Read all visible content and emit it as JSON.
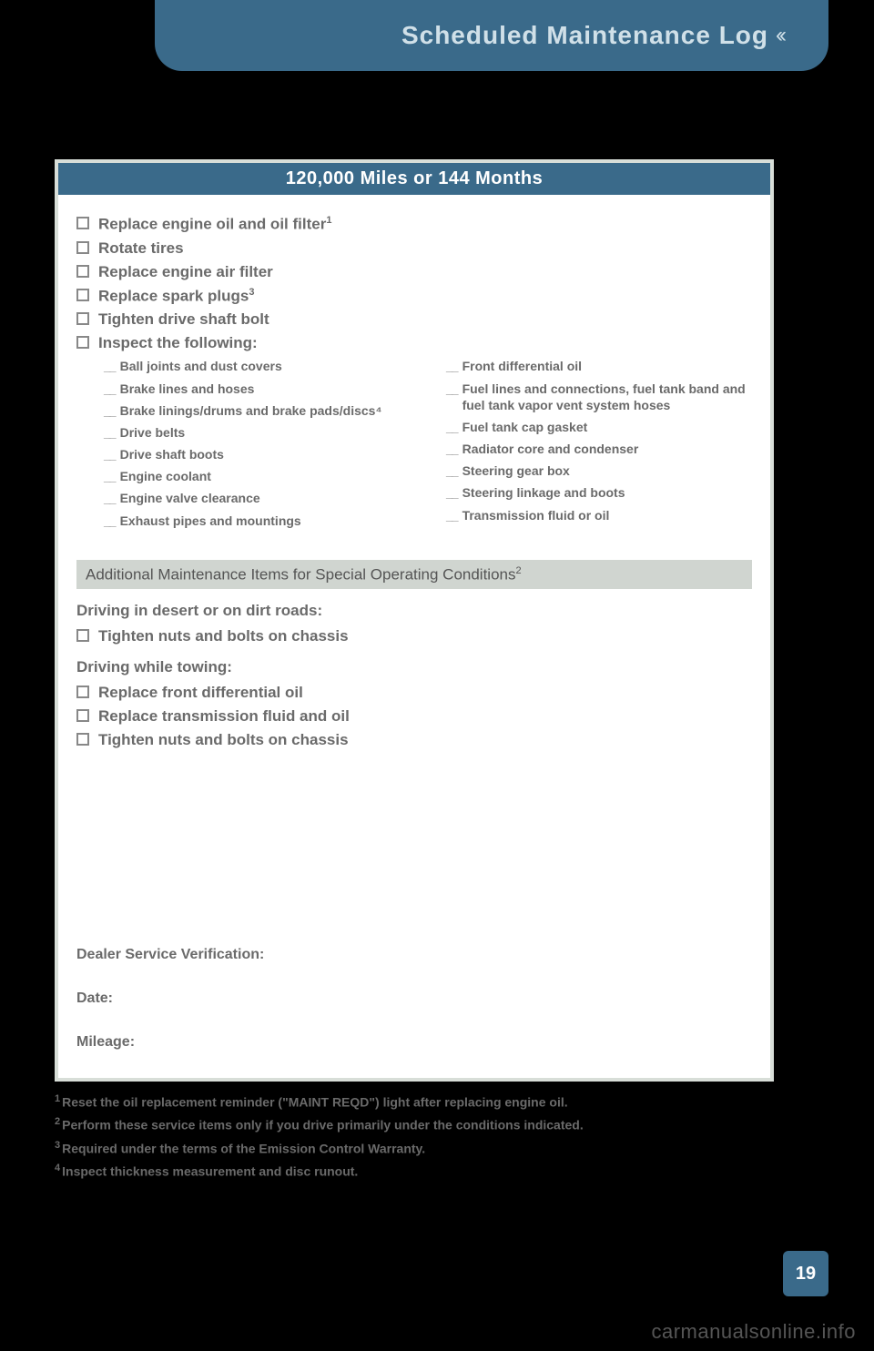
{
  "header": {
    "title": "Scheduled Maintenance Log",
    "chevrons": "‹‹"
  },
  "card": {
    "title": "120,000 Miles or 144 Months",
    "checklist": [
      {
        "text": "Replace engine oil and oil filter",
        "sup": "1"
      },
      {
        "text": "Rotate tires",
        "sup": ""
      },
      {
        "text": "Replace engine air filter",
        "sup": ""
      },
      {
        "text": "Replace spark plugs",
        "sup": "3"
      },
      {
        "text": "Tighten drive shaft bolt",
        "sup": ""
      },
      {
        "text": "Inspect the following:",
        "sup": ""
      }
    ],
    "inspect_left": [
      "Ball joints and dust covers",
      "Brake lines and hoses",
      "Brake linings/drums and brake pads/discs⁴",
      "Drive belts",
      "Drive shaft boots",
      "Engine coolant",
      "Engine valve clearance",
      "Exhaust pipes and mountings"
    ],
    "inspect_right": [
      "Front differential oil",
      "Fuel lines and connections, fuel tank band and fuel tank vapor vent system hoses",
      "Fuel tank cap gasket",
      "Radiator core and condenser",
      "Steering gear box",
      "Steering linkage and boots",
      "Transmission fluid or oil"
    ],
    "subheader": {
      "text": "Additional Maintenance Items for Special Operating Conditions",
      "sup": "2"
    },
    "special": {
      "desert_label": "Driving in desert or on dirt roads:",
      "desert_items": [
        "Tighten nuts and bolts on chassis"
      ],
      "towing_label": "Driving while towing:",
      "towing_items": [
        "Replace front differential oil",
        "Replace transmission fluid and oil",
        "Tighten nuts and bolts on chassis"
      ]
    },
    "verification": {
      "dealer": "Dealer Service Verification:",
      "date": "Date:",
      "mileage": "Mileage:"
    }
  },
  "footnotes": [
    {
      "num": "1",
      "text": "Reset the oil replacement reminder (\"MAINT REQD\") light after replacing engine oil."
    },
    {
      "num": "2",
      "text": "Perform these service items only if you drive primarily under the conditions indicated."
    },
    {
      "num": "3",
      "text": "Required under the terms of the Emission Control Warranty."
    },
    {
      "num": "4",
      "text": "Inspect thickness measurement and disc runout."
    }
  ],
  "page_number": "19",
  "watermark": "carmanualsonline.info"
}
